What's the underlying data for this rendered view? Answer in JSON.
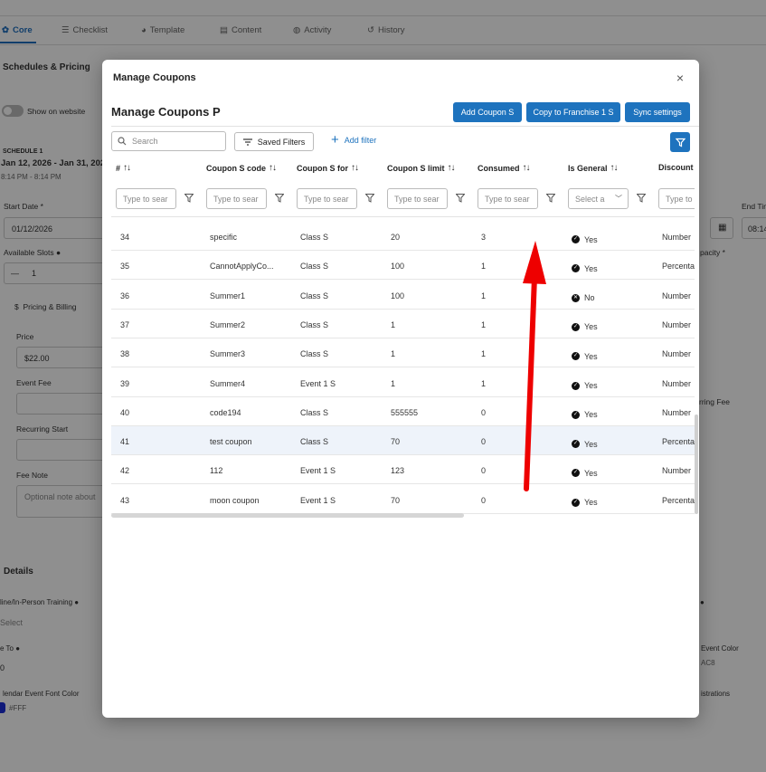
{
  "background": {
    "tabs": [
      "Core",
      "Checklist",
      "Template",
      "Content",
      "Activity",
      "History"
    ],
    "section_title": "Schedules & Pricing",
    "show_on_website": "Show on website",
    "schedule_label": "SCHEDULE 1",
    "schedule_dates": "Jan 12, 2026 - Jan 31, 202",
    "schedule_time": "8:14 PM - 8:14 PM",
    "start_date_label": "Start Date *",
    "start_date_value": "01/12/2026",
    "end_time_label": "End Tin",
    "end_time_value": "08:14",
    "available_slots_label": "Available Slots",
    "slots_minus": "—",
    "slots_value": "1",
    "capacity_label": "pacity *",
    "pricing_billing": "Pricing & Billing",
    "price_label": "Price",
    "price_value": "$22.00",
    "event_fee_label": "Event Fee",
    "recurring_fee_label": "rring Fee",
    "recurring_start_label": "Recurring Start",
    "fee_note_label": "Fee Note",
    "fee_note_placeholder": "Optional note about",
    "details_title": "Details",
    "online_training_label": "line/In-Person Training",
    "select_placeholder": "Select",
    "e_to_label": "e To",
    "e_to_value": "0",
    "font_color_label": "lendar Event Font Color",
    "font_color_value": "#FFF",
    "event_color_label": "Event Color",
    "event_color_value": "AC8",
    "registrations_label": "istrations"
  },
  "modal": {
    "title": "Manage Coupons",
    "subtitle": "Manage Coupons P",
    "buttons": {
      "add": "Add Coupon S",
      "copy": "Copy to Franchise 1 S",
      "sync": "Sync settings"
    },
    "search_placeholder": "Search",
    "saved_filters": "Saved Filters",
    "add_filter": "Add filter",
    "columns": [
      "#",
      "Coupon S code",
      "Coupon S for",
      "Coupon S limit",
      "Consumed",
      "Is General",
      "Discount"
    ],
    "filter_placeholder": "Type to sear",
    "filter_placeholder_short": "Type to",
    "select_placeholder": "Select a",
    "rows": [
      {
        "id": "34",
        "code": "specific",
        "for": "Class S",
        "limit": "20",
        "consumed": "3",
        "general": "Yes",
        "discount": "Number"
      },
      {
        "id": "35",
        "code": "CannotApplyCo...",
        "for": "Class S",
        "limit": "100",
        "consumed": "1",
        "general": "Yes",
        "discount": "Percenta"
      },
      {
        "id": "36",
        "code": "Summer1",
        "for": "Class S",
        "limit": "100",
        "consumed": "1",
        "general": "No",
        "discount": "Number"
      },
      {
        "id": "37",
        "code": "Summer2",
        "for": "Class S",
        "limit": "1",
        "consumed": "1",
        "general": "Yes",
        "discount": "Number"
      },
      {
        "id": "38",
        "code": "Summer3",
        "for": "Class S",
        "limit": "1",
        "consumed": "1",
        "general": "Yes",
        "discount": "Number"
      },
      {
        "id": "39",
        "code": "Summer4",
        "for": "Event 1 S",
        "limit": "1",
        "consumed": "1",
        "general": "Yes",
        "discount": "Number"
      },
      {
        "id": "40",
        "code": "code194",
        "for": "Class S",
        "limit": "555555",
        "consumed": "0",
        "general": "Yes",
        "discount": "Number"
      },
      {
        "id": "41",
        "code": "test coupon",
        "for": "Class S",
        "limit": "70",
        "consumed": "0",
        "general": "Yes",
        "discount": "Percenta"
      },
      {
        "id": "42",
        "code": "112",
        "for": "Event 1 S",
        "limit": "123",
        "consumed": "0",
        "general": "Yes",
        "discount": "Number"
      },
      {
        "id": "43",
        "code": "moon coupon",
        "for": "Event 1 S",
        "limit": "70",
        "consumed": "0",
        "general": "Yes",
        "discount": "Percenta"
      }
    ],
    "highlighted_row": "41"
  },
  "colors": {
    "primary": "#1e73be",
    "annotation_arrow": "#ee0000",
    "row_highlight": "#eef3fa"
  }
}
